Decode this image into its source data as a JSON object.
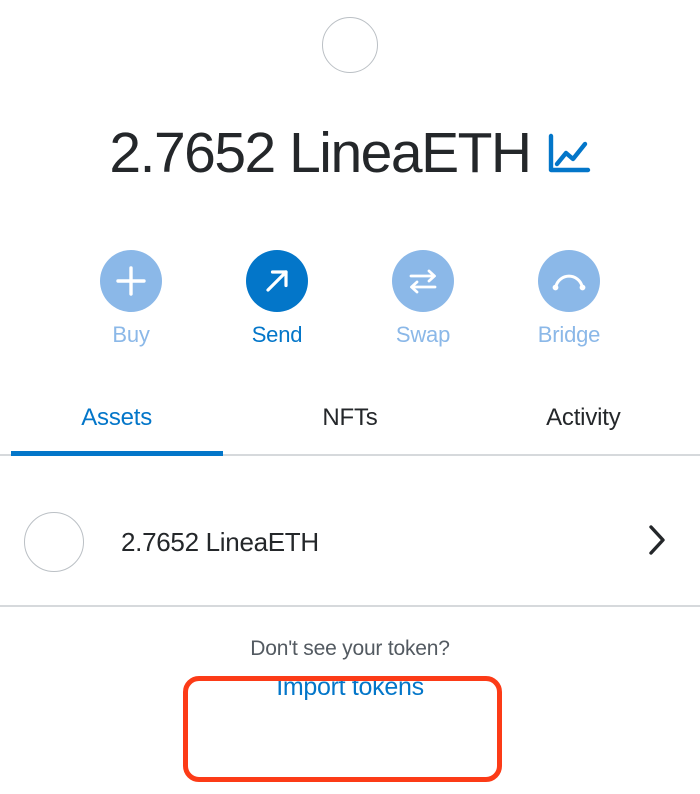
{
  "account": {
    "avatar_icon": "account-avatar-circle"
  },
  "balance": {
    "amount": "2.7652",
    "currency": "LineaETH",
    "display": "2.7652 LineaETH",
    "chart_icon": "line-chart-icon"
  },
  "actions": [
    {
      "label": "Buy",
      "icon": "plus-icon",
      "active": false
    },
    {
      "label": "Send",
      "icon": "arrow-up-right-icon",
      "active": true
    },
    {
      "label": "Swap",
      "icon": "swap-arrows-icon",
      "active": false
    },
    {
      "label": "Bridge",
      "icon": "bridge-arc-icon",
      "active": false
    }
  ],
  "tabs": [
    {
      "label": "Assets",
      "active": true
    },
    {
      "label": "NFTs",
      "active": false
    },
    {
      "label": "Activity",
      "active": false
    }
  ],
  "tokens": [
    {
      "name": "2.7652 LineaETH",
      "token_icon": "token-avatar-circle",
      "chevron_icon": "chevron-right-icon"
    }
  ],
  "footer": {
    "prompt": "Don't see your token?",
    "import_link": "Import tokens"
  },
  "colors": {
    "accent": "#0376c9",
    "accent_muted": "#8bb8e8",
    "text": "#24272a",
    "text_muted": "#535a61",
    "divider": "#d6d9dc",
    "highlight": "#fc3b17",
    "background": "#ffffff"
  }
}
